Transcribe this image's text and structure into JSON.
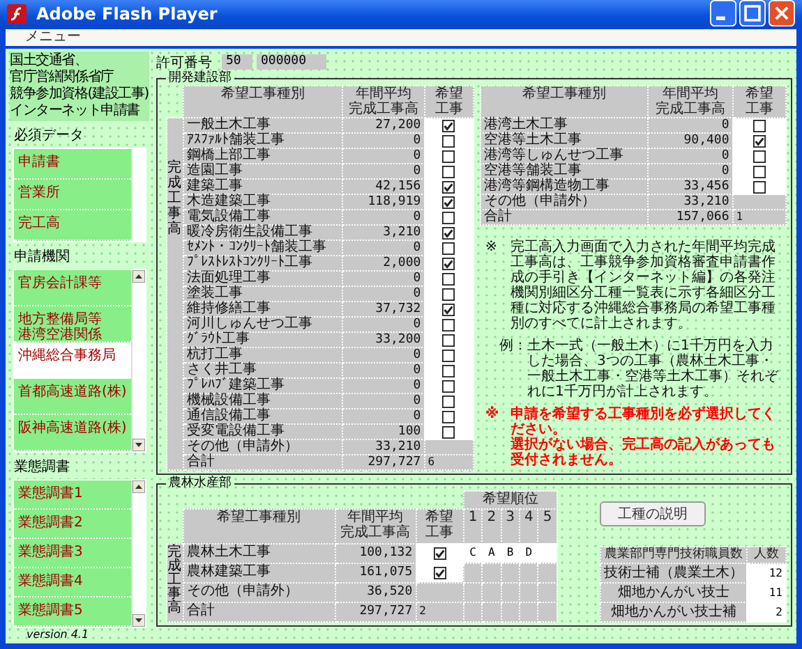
{
  "window": {
    "title": "Adobe Flash Player"
  },
  "menu": [
    {
      "label": "メニュー"
    }
  ],
  "sidebar": {
    "header_lines": [
      "国土交通省、",
      "官庁営繕関係省庁",
      "競争参加資格(建設工事)",
      "インターネット申請書"
    ],
    "sections": [
      {
        "title": "必須データ",
        "scrollable": false,
        "items": [
          {
            "lines": [
              "申請書"
            ],
            "selected": false
          },
          {
            "lines": [
              "営業所"
            ],
            "selected": false
          },
          {
            "lines": [
              "完工高"
            ],
            "selected": false
          }
        ]
      },
      {
        "title": "申請機関",
        "scrollable": true,
        "items": [
          {
            "lines": [
              "官房会計課等"
            ],
            "selected": false
          },
          {
            "lines": [
              "地方整備局等",
              "港湾空港関係"
            ],
            "selected": false
          },
          {
            "lines": [
              "沖縄総合事務局"
            ],
            "selected": true
          },
          {
            "lines": [
              "首都高速道路(株)"
            ],
            "selected": false
          },
          {
            "lines": [
              "阪神高速道路(株)"
            ],
            "selected": false
          }
        ]
      },
      {
        "title": "業態調書",
        "scrollable": true,
        "items": [
          {
            "lines": [
              "業態調書1"
            ],
            "selected": false
          },
          {
            "lines": [
              "業態調書2"
            ],
            "selected": false
          },
          {
            "lines": [
              "業態調書3"
            ],
            "selected": false
          },
          {
            "lines": [
              "業態調書4"
            ],
            "selected": false
          },
          {
            "lines": [
              "業態調書5"
            ],
            "selected": false
          }
        ]
      }
    ],
    "version": "version 4.1"
  },
  "permit": {
    "label": "許可番号",
    "values": [
      "50",
      "000000"
    ]
  },
  "kaihatsu": {
    "title": "開発建設部",
    "side_label": "完成工事高",
    "tables": [
      {
        "columns": [
          {
            "lines": [
              "希望工事種別"
            ]
          },
          {
            "lines": [
              "年間平均",
              "完成工事高"
            ]
          },
          {
            "lines": [
              "希望",
              "工事"
            ]
          }
        ],
        "rows": [
          {
            "kind": "work",
            "name": "一般土木工事",
            "amount": "27,200",
            "checked": true
          },
          {
            "kind": "work",
            "name": "ｱｽﾌｧﾙﾄ舗装工事",
            "amount": "0",
            "checked": false
          },
          {
            "kind": "work",
            "name": "鋼橋上部工事",
            "amount": "0",
            "checked": false
          },
          {
            "kind": "work",
            "name": "造園工事",
            "amount": "0",
            "checked": false
          },
          {
            "kind": "work",
            "name": "建築工事",
            "amount": "42,156",
            "checked": true
          },
          {
            "kind": "work",
            "name": "木造建築工事",
            "amount": "118,919",
            "checked": true
          },
          {
            "kind": "work",
            "name": "電気設備工事",
            "amount": "0",
            "checked": false
          },
          {
            "kind": "work",
            "name": "暖冷房衛生設備工事",
            "amount": "3,210",
            "checked": true
          },
          {
            "kind": "work",
            "name": "ｾﾒﾝﾄ・ｺﾝｸﾘｰﾄ舗装工事",
            "amount": "0",
            "checked": false
          },
          {
            "kind": "work",
            "name": "ﾌﾟﾚｽﾄﾚｽﾄｺﾝｸﾘｰﾄ工事",
            "amount": "2,000",
            "checked": true
          },
          {
            "kind": "work",
            "name": "法面処理工事",
            "amount": "0",
            "checked": false
          },
          {
            "kind": "work",
            "name": "塗装工事",
            "amount": "0",
            "checked": false
          },
          {
            "kind": "work",
            "name": "維持修繕工事",
            "amount": "37,732",
            "checked": true
          },
          {
            "kind": "work",
            "name": "河川しゅんせつ工事",
            "amount": "0",
            "checked": false
          },
          {
            "kind": "work",
            "name": "ｸﾞﾗｳﾄ工事",
            "amount": "33,200",
            "checked": false
          },
          {
            "kind": "work",
            "name": "杭打工事",
            "amount": "0",
            "checked": false
          },
          {
            "kind": "work",
            "name": "さく井工事",
            "amount": "0",
            "checked": false
          },
          {
            "kind": "work",
            "name": "ﾌﾟﾚﾊﾌﾞ建築工事",
            "amount": "0",
            "checked": false
          },
          {
            "kind": "work",
            "name": "機械設備工事",
            "amount": "0",
            "checked": false
          },
          {
            "kind": "work",
            "name": "通信設備工事",
            "amount": "0",
            "checked": false
          },
          {
            "kind": "work",
            "name": "受変電設備工事",
            "amount": "100",
            "checked": false
          },
          {
            "kind": "other",
            "name": "その他（申請外）",
            "amount": "33,210"
          },
          {
            "kind": "total",
            "name": "合計",
            "amount": "297,727",
            "count": "6"
          }
        ]
      },
      {
        "columns": [
          {
            "lines": [
              "希望工事種別"
            ]
          },
          {
            "lines": [
              "年間平均",
              "完成工事高"
            ]
          },
          {
            "lines": [
              "希望",
              "工事"
            ]
          }
        ],
        "rows": [
          {
            "kind": "work",
            "name": "港湾土木工事",
            "amount": "0",
            "checked": false
          },
          {
            "kind": "work",
            "name": "空港等土木工事",
            "amount": "90,400",
            "checked": true
          },
          {
            "kind": "work",
            "name": "港湾等しゅんせつ工事",
            "amount": "0",
            "checked": false
          },
          {
            "kind": "work",
            "name": "空港等舗装工事",
            "amount": "0",
            "checked": false
          },
          {
            "kind": "work",
            "name": "港湾等鋼構造物工事",
            "amount": "33,456",
            "checked": false
          },
          {
            "kind": "other",
            "name": "その他（申請外）",
            "amount": "33,210"
          },
          {
            "kind": "total",
            "name": "合計",
            "amount": "157,066",
            "count": "1"
          }
        ]
      }
    ],
    "notes": [
      {
        "kind": "note",
        "mark": "※",
        "lines": [
          "完工高入力画面で入力された年間平均完成工事高は、工事競争参加資格審査申請書作成の手引き【インターネット編】の各発注機関別細区分工種一覧表に示す各細区分工種に対応する沖縄総合事務局の希望工事種別のすべてに計上されます。"
        ]
      },
      {
        "kind": "example",
        "mark": "例：",
        "lines": [
          "土木一式（一般土木）に1千万円を入力した場合、3つの工事（農林土木工事・一般土木工事・空港等土木工事）それぞれに1千万円が計上されます。"
        ]
      },
      {
        "kind": "warning",
        "mark": "※",
        "lines": [
          "申請を希望する工事種別を必ず選択してください。",
          "選択がない場合、完工高の記入があっても受付されません。"
        ]
      }
    ]
  },
  "norin": {
    "title": "農林水産部",
    "side_label": "完成工事高",
    "columns": [
      {
        "lines": [
          "希望工事種別"
        ]
      },
      {
        "lines": [
          "年間平均",
          "完成工事高"
        ]
      },
      {
        "lines": [
          "希望",
          "工事"
        ]
      }
    ],
    "rank_header": "希望順位",
    "rank_columns": [
      "1",
      "2",
      "3",
      "4",
      "5"
    ],
    "rows": [
      {
        "kind": "work",
        "name": "農林土木工事",
        "amount": "100,132",
        "checked": true,
        "ranks": [
          "C",
          "A",
          "B",
          "D"
        ]
      },
      {
        "kind": "work",
        "name": "農林建築工事",
        "amount": "161,075",
        "checked": true
      },
      {
        "kind": "other",
        "name": "その他（申請外）",
        "amount": "36,520"
      },
      {
        "kind": "total",
        "name": "合計",
        "amount": "297,727",
        "count": "2"
      }
    ],
    "button": "工種の説明",
    "staff": {
      "columns": [
        "農業部門専門技術職員数",
        "人数"
      ],
      "rows": [
        {
          "name": "技術士補（農業土木）",
          "count": "12"
        },
        {
          "name": "畑地かんがい技士",
          "count": "11"
        },
        {
          "name": "畑地かんがい技士補",
          "count": "2"
        }
      ]
    }
  }
}
